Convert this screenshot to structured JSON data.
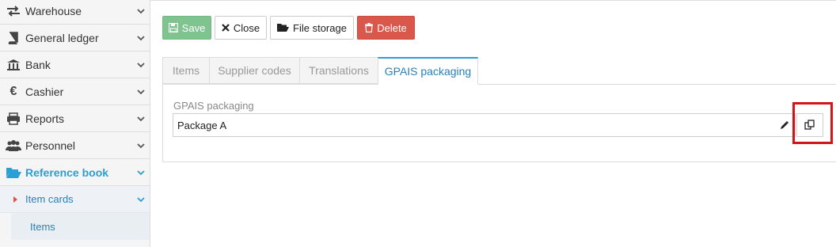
{
  "sidebar": {
    "items": [
      {
        "label": "Warehouse",
        "icon": "arrows-exchange-icon"
      },
      {
        "label": "General ledger",
        "icon": "book-icon"
      },
      {
        "label": "Bank",
        "icon": "bank-icon"
      },
      {
        "label": "Cashier",
        "icon": "euro-icon"
      },
      {
        "label": "Reports",
        "icon": "printer-icon"
      },
      {
        "label": "Personnel",
        "icon": "users-icon"
      },
      {
        "label": "Reference book",
        "icon": "folder-open-icon"
      }
    ],
    "sub_item": "Item cards",
    "leaf_item": "Items"
  },
  "toolbar": {
    "save_label": "Save",
    "close_label": "Close",
    "file_storage_label": "File storage",
    "delete_label": "Delete"
  },
  "tabs": [
    {
      "label": "Items"
    },
    {
      "label": "Supplier codes"
    },
    {
      "label": "Translations"
    },
    {
      "label": "GPAIS packaging",
      "active": true
    }
  ],
  "form": {
    "field_label": "GPAIS packaging",
    "field_value": "Package A"
  },
  "colors": {
    "accent": "#2a9fd6",
    "save": "#7fc48f",
    "delete": "#d9574b",
    "highlight": "#d4141b"
  }
}
